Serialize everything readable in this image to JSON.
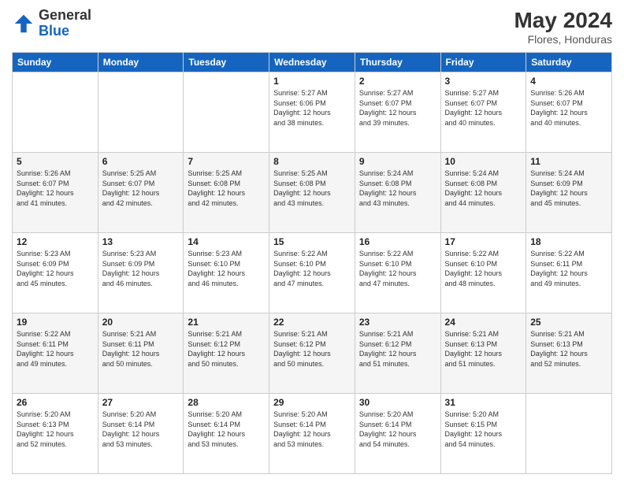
{
  "header": {
    "logo_general": "General",
    "logo_blue": "Blue",
    "month": "May 2024",
    "location": "Flores, Honduras"
  },
  "weekdays": [
    "Sunday",
    "Monday",
    "Tuesday",
    "Wednesday",
    "Thursday",
    "Friday",
    "Saturday"
  ],
  "weeks": [
    [
      {
        "day": "",
        "info": ""
      },
      {
        "day": "",
        "info": ""
      },
      {
        "day": "",
        "info": ""
      },
      {
        "day": "1",
        "info": "Sunrise: 5:27 AM\nSunset: 6:06 PM\nDaylight: 12 hours\nand 38 minutes."
      },
      {
        "day": "2",
        "info": "Sunrise: 5:27 AM\nSunset: 6:07 PM\nDaylight: 12 hours\nand 39 minutes."
      },
      {
        "day": "3",
        "info": "Sunrise: 5:27 AM\nSunset: 6:07 PM\nDaylight: 12 hours\nand 40 minutes."
      },
      {
        "day": "4",
        "info": "Sunrise: 5:26 AM\nSunset: 6:07 PM\nDaylight: 12 hours\nand 40 minutes."
      }
    ],
    [
      {
        "day": "5",
        "info": "Sunrise: 5:26 AM\nSunset: 6:07 PM\nDaylight: 12 hours\nand 41 minutes."
      },
      {
        "day": "6",
        "info": "Sunrise: 5:25 AM\nSunset: 6:07 PM\nDaylight: 12 hours\nand 42 minutes."
      },
      {
        "day": "7",
        "info": "Sunrise: 5:25 AM\nSunset: 6:08 PM\nDaylight: 12 hours\nand 42 minutes."
      },
      {
        "day": "8",
        "info": "Sunrise: 5:25 AM\nSunset: 6:08 PM\nDaylight: 12 hours\nand 43 minutes."
      },
      {
        "day": "9",
        "info": "Sunrise: 5:24 AM\nSunset: 6:08 PM\nDaylight: 12 hours\nand 43 minutes."
      },
      {
        "day": "10",
        "info": "Sunrise: 5:24 AM\nSunset: 6:08 PM\nDaylight: 12 hours\nand 44 minutes."
      },
      {
        "day": "11",
        "info": "Sunrise: 5:24 AM\nSunset: 6:09 PM\nDaylight: 12 hours\nand 45 minutes."
      }
    ],
    [
      {
        "day": "12",
        "info": "Sunrise: 5:23 AM\nSunset: 6:09 PM\nDaylight: 12 hours\nand 45 minutes."
      },
      {
        "day": "13",
        "info": "Sunrise: 5:23 AM\nSunset: 6:09 PM\nDaylight: 12 hours\nand 46 minutes."
      },
      {
        "day": "14",
        "info": "Sunrise: 5:23 AM\nSunset: 6:10 PM\nDaylight: 12 hours\nand 46 minutes."
      },
      {
        "day": "15",
        "info": "Sunrise: 5:22 AM\nSunset: 6:10 PM\nDaylight: 12 hours\nand 47 minutes."
      },
      {
        "day": "16",
        "info": "Sunrise: 5:22 AM\nSunset: 6:10 PM\nDaylight: 12 hours\nand 47 minutes."
      },
      {
        "day": "17",
        "info": "Sunrise: 5:22 AM\nSunset: 6:10 PM\nDaylight: 12 hours\nand 48 minutes."
      },
      {
        "day": "18",
        "info": "Sunrise: 5:22 AM\nSunset: 6:11 PM\nDaylight: 12 hours\nand 49 minutes."
      }
    ],
    [
      {
        "day": "19",
        "info": "Sunrise: 5:22 AM\nSunset: 6:11 PM\nDaylight: 12 hours\nand 49 minutes."
      },
      {
        "day": "20",
        "info": "Sunrise: 5:21 AM\nSunset: 6:11 PM\nDaylight: 12 hours\nand 50 minutes."
      },
      {
        "day": "21",
        "info": "Sunrise: 5:21 AM\nSunset: 6:12 PM\nDaylight: 12 hours\nand 50 minutes."
      },
      {
        "day": "22",
        "info": "Sunrise: 5:21 AM\nSunset: 6:12 PM\nDaylight: 12 hours\nand 50 minutes."
      },
      {
        "day": "23",
        "info": "Sunrise: 5:21 AM\nSunset: 6:12 PM\nDaylight: 12 hours\nand 51 minutes."
      },
      {
        "day": "24",
        "info": "Sunrise: 5:21 AM\nSunset: 6:13 PM\nDaylight: 12 hours\nand 51 minutes."
      },
      {
        "day": "25",
        "info": "Sunrise: 5:21 AM\nSunset: 6:13 PM\nDaylight: 12 hours\nand 52 minutes."
      }
    ],
    [
      {
        "day": "26",
        "info": "Sunrise: 5:20 AM\nSunset: 6:13 PM\nDaylight: 12 hours\nand 52 minutes."
      },
      {
        "day": "27",
        "info": "Sunrise: 5:20 AM\nSunset: 6:14 PM\nDaylight: 12 hours\nand 53 minutes."
      },
      {
        "day": "28",
        "info": "Sunrise: 5:20 AM\nSunset: 6:14 PM\nDaylight: 12 hours\nand 53 minutes."
      },
      {
        "day": "29",
        "info": "Sunrise: 5:20 AM\nSunset: 6:14 PM\nDaylight: 12 hours\nand 53 minutes."
      },
      {
        "day": "30",
        "info": "Sunrise: 5:20 AM\nSunset: 6:14 PM\nDaylight: 12 hours\nand 54 minutes."
      },
      {
        "day": "31",
        "info": "Sunrise: 5:20 AM\nSunset: 6:15 PM\nDaylight: 12 hours\nand 54 minutes."
      },
      {
        "day": "",
        "info": ""
      }
    ]
  ]
}
